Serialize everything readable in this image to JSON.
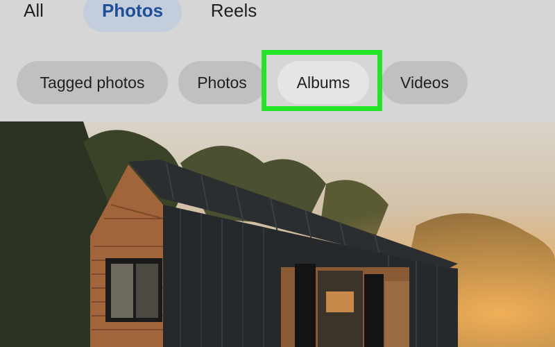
{
  "top_tabs": [
    {
      "label": "All",
      "selected": false
    },
    {
      "label": "Photos",
      "selected": true
    },
    {
      "label": "Reels",
      "selected": false
    }
  ],
  "filter_chips": [
    {
      "label": "Tagged photos",
      "selected": false
    },
    {
      "label": "Photos",
      "selected": false
    },
    {
      "label": "Albums",
      "selected": true,
      "highlighted": true
    },
    {
      "label": "Videos",
      "selected": false
    }
  ],
  "colors": {
    "selected_tab_bg": "#c3cddb",
    "selected_tab_text": "#1d4e99",
    "highlight_box": "#22e52a"
  }
}
